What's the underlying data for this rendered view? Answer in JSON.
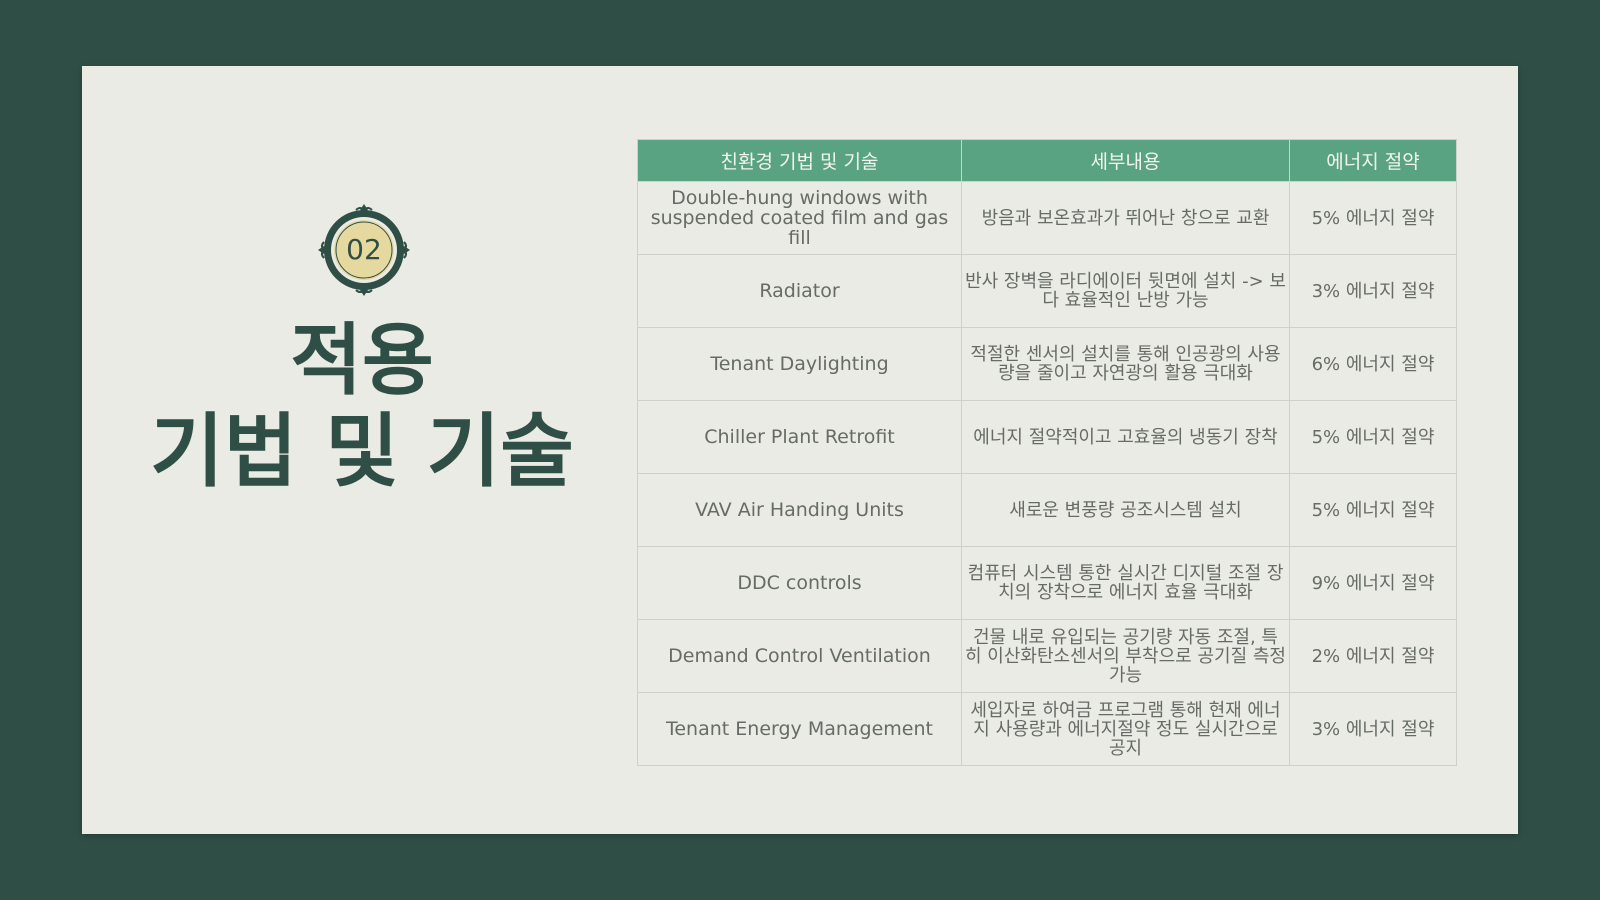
{
  "section": {
    "number": "02",
    "title_line1": "적용",
    "title_line2": "기법 및 기술"
  },
  "colors": {
    "background": "#2f4f46",
    "slide": "#ebebe5",
    "header": "#5aa382",
    "emblem_fill": "#e6d9a0"
  },
  "table": {
    "headers": [
      "친환경 기법 및 기술",
      "세부내용",
      "에너지 절약"
    ],
    "rows": [
      {
        "tech": "Double-hung windows with suspended coated film and gas fill",
        "detail": "방음과 보온효과가 뛰어난 창으로 교환",
        "saving": "5% 에너지 절약"
      },
      {
        "tech": "Radiator",
        "detail": "반사 장벽을 라디에이터 뒷면에 설치 -> 보다 효율적인 난방 가능",
        "saving": "3% 에너지 절약"
      },
      {
        "tech": "Tenant Daylighting",
        "detail": "적절한 센서의 설치를 통해 인공광의 사용량을 줄이고 자연광의 활용 극대화",
        "saving": "6% 에너지 절약"
      },
      {
        "tech": "Chiller Plant Retrofit",
        "detail": "에너지 절약적이고 고효율의 냉동기 장착",
        "saving": "5% 에너지 절약"
      },
      {
        "tech": "VAV  Air Handing  Units",
        "detail": "새로운 변풍량 공조시스템 설치",
        "saving": "5% 에너지 절약"
      },
      {
        "tech": "DDC controls",
        "detail": "컴퓨터 시스템 통한 실시간 디지털 조절 장치의 장착으로 에너지 효율 극대화",
        "saving": "9% 에너지 절약"
      },
      {
        "tech": "Demand Control Ventilation",
        "detail": "건물 내로 유입되는 공기량 자동 조절, 특히 이산화탄소센서의 부착으로 공기질 측정 가능",
        "saving": "2% 에너지 절약"
      },
      {
        "tech": "Tenant Energy Management",
        "detail": "세입자로 하여금 프로그램 통해 현재 에너지 사용량과 에너지절약 정도 실시간으로 공지",
        "saving": "3% 에너지 절약"
      }
    ]
  }
}
